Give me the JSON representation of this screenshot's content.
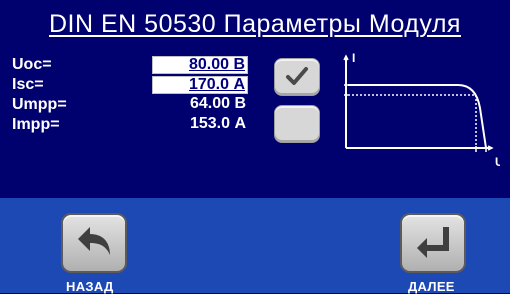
{
  "title": "DIN EN 50530 Параметры Модуля",
  "params": [
    {
      "label": "Uoc=",
      "value": "80.00 В",
      "editable": true
    },
    {
      "label": "Isc=",
      "value": "170.0 А",
      "editable": true
    },
    {
      "label": "Umpp=",
      "value": "64.00 В",
      "editable": false
    },
    {
      "label": "Impp=",
      "value": "153.0 А",
      "editable": false
    }
  ],
  "toggles": [
    {
      "name": "checked",
      "checked": true
    },
    {
      "name": "unchecked",
      "checked": false
    }
  ],
  "graph": {
    "y_axis_label": "I",
    "x_axis_label": "U"
  },
  "nav": {
    "back_label": "НАЗАД",
    "next_label": "ДАЛЕЕ"
  },
  "colors": {
    "background": "#00006e",
    "bottom_bar": "#1c49b3",
    "button": "#d7d7d7"
  }
}
